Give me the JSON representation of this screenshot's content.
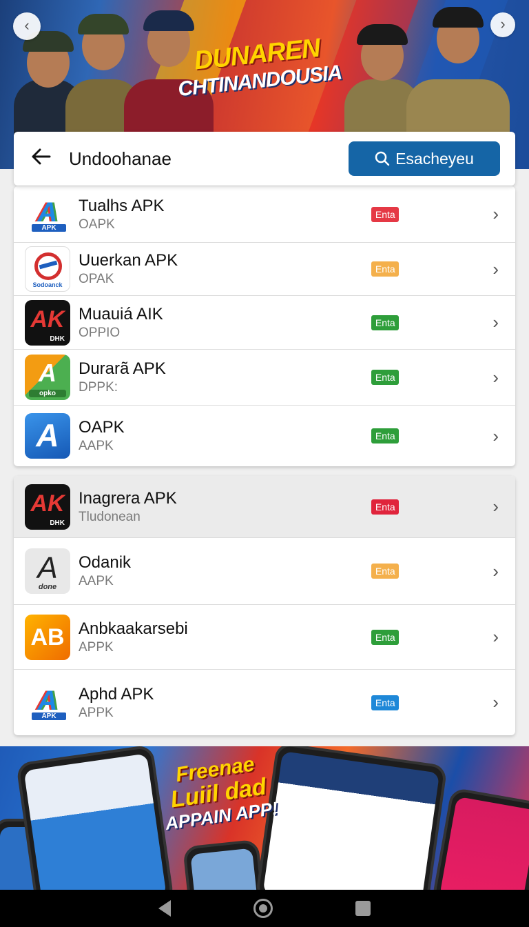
{
  "top_banner": {
    "title_line1": "DUNAREN",
    "title_line2": "CHTINANDOUSIA"
  },
  "header": {
    "title": "Undoohanae",
    "search_label": "Esacheyeu"
  },
  "list_group_1": [
    {
      "name": "Tualhs APK",
      "sub": "OAPK",
      "badge": "Enta",
      "badge_color": "#e53945",
      "icon_bg": "#ffffff",
      "icon_fg": "#1e88e5",
      "icon_text": "A",
      "icon_mini": "APK",
      "icon_name": "apk-rainbow-icon"
    },
    {
      "name": "Uuerkan APK",
      "sub": "OPAK",
      "badge": "Enta",
      "badge_color": "#f4b04c",
      "icon_bg": "#ffffff",
      "icon_fg": "#d32f2f",
      "icon_text": "Q",
      "icon_mini": "Sodoanck",
      "icon_name": "circle-logo-icon"
    },
    {
      "name": "Muauiá AIK",
      "sub": "OPPIO",
      "badge": "Enta",
      "badge_color": "#2e9e3a",
      "icon_bg": "#111111",
      "icon_fg": "#e53935",
      "icon_text": "AK",
      "icon_mini": "DHK",
      "icon_name": "ak-logo-icon"
    },
    {
      "name": "Durarã APK",
      "sub": "DPPK:",
      "badge": "Enta",
      "badge_color": "#2e9e3a",
      "icon_bg": "#4caf50",
      "icon_fg": "#ffffff",
      "icon_text": "A",
      "icon_mini": "opko",
      "icon_name": "green-orange-apk-icon"
    },
    {
      "name": "OAPK",
      "sub": "AAPK",
      "badge": "Enta",
      "badge_color": "#2e9e3a",
      "icon_bg": "#1e74d0",
      "icon_fg": "#ffffff",
      "icon_text": "A",
      "icon_mini": "",
      "icon_name": "blue-a-icon"
    }
  ],
  "list_group_2": [
    {
      "name": "Inagrera APK",
      "sub": "Tludonean",
      "badge": "Enta",
      "badge_color": "#e0243c",
      "icon_bg": "#111111",
      "icon_fg": "#e53935",
      "icon_text": "AK",
      "icon_mini": "DHK",
      "icon_name": "ak-logo-icon"
    },
    {
      "name": "Odanik",
      "sub": "AAPK",
      "badge": "Enta",
      "badge_color": "#f4b04c",
      "icon_bg": "#e8e8e8",
      "icon_fg": "#222222",
      "icon_text": "A",
      "icon_mini": "done",
      "icon_name": "sketch-a-icon"
    },
    {
      "name": "Anbkaakarsebi",
      "sub": "APPK",
      "badge": "Enta",
      "badge_color": "#2e9e3a",
      "icon_bg": "#f39c12",
      "icon_fg": "#ffffff",
      "icon_text": "AB",
      "icon_mini": "",
      "icon_name": "ab-orange-icon"
    },
    {
      "name": "Aphd APK",
      "sub": "APPK",
      "badge": "Enta",
      "badge_color": "#1e88d8",
      "icon_bg": "#ffffff",
      "icon_fg": "#1e88e5",
      "icon_text": "A",
      "icon_mini": "APK",
      "icon_name": "apk-rainbow-icon"
    }
  ],
  "bottom_banner": {
    "promo_line1": "Freenae",
    "promo_line2": "Luiil dad",
    "promo_line3": "APPAIN APP!"
  },
  "icons": {
    "back": "back-arrow-icon",
    "search": "search-icon",
    "chevron": "chevron-right-icon"
  }
}
